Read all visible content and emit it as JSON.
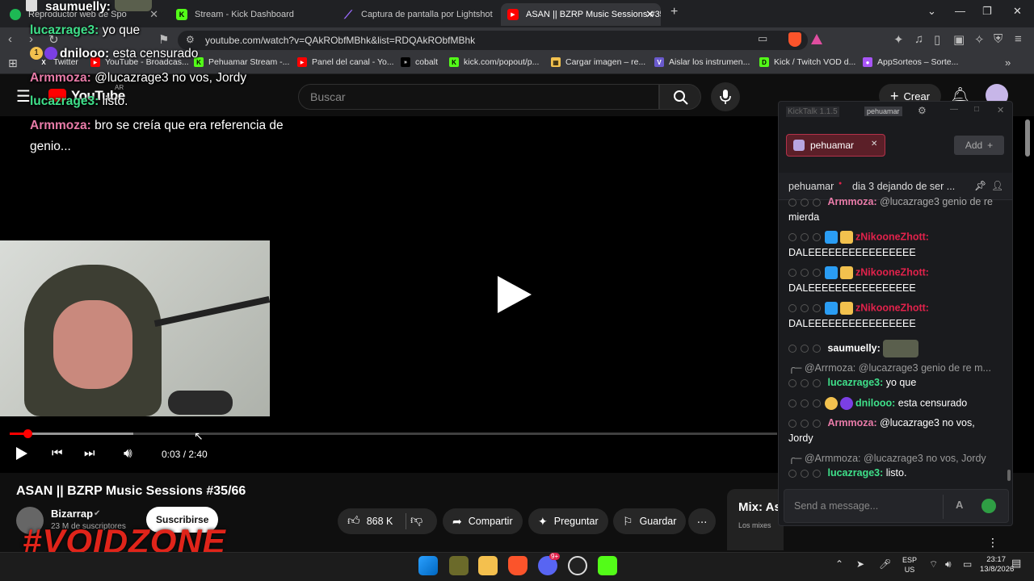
{
  "tabs": [
    {
      "title": "Reproductor web de Spo",
      "fav_color": "#1db954"
    },
    {
      "title": "Stream - Kick Dashboard",
      "fav_color": "#53fc18"
    },
    {
      "title": "Captura de pantalla por Lightshot",
      "fav_color": "#9b6bff"
    },
    {
      "title": "ASAN || BZRP Music Sessions #35/",
      "fav_color": "#ff0000",
      "active": true
    }
  ],
  "address": {
    "url": "youtube.com/watch?v=QAkRObfMBhk&list=RDQAkRObfMBhk"
  },
  "bookmarks": [
    {
      "label": "Twitter",
      "icon": "x-icon"
    },
    {
      "label": "YouTube - Broadcas...",
      "icon": "youtube-icon"
    },
    {
      "label": "Pehuamar Stream -...",
      "icon": "kick-icon"
    },
    {
      "label": "Panel del canal - Yo...",
      "icon": "youtube-icon"
    },
    {
      "label": "cobalt",
      "icon": "cobalt-icon"
    },
    {
      "label": "kick.com/popout/p...",
      "icon": "kick-icon"
    },
    {
      "label": "Cargar imagen – re...",
      "icon": "image-icon"
    },
    {
      "label": "Aislar los instrumen...",
      "icon": "v-icon"
    },
    {
      "label": "Kick / Twitch VOD d...",
      "icon": "d-icon"
    },
    {
      "label": "AppSorteos – Sorte...",
      "icon": "app-icon"
    }
  ],
  "youtube": {
    "logo_text": "YouTube",
    "region": "AR",
    "search_placeholder": "Buscar",
    "create_label": "Crear"
  },
  "overlay_chat": [
    {
      "user": "saumuelly:",
      "text": "",
      "color": "#ffffff"
    },
    {
      "user": "lucazrage3:",
      "text": "yo que",
      "color": "#3fe08a"
    },
    {
      "user": "dnilooo:",
      "text": "esta censurado",
      "color": "#3fe08a"
    },
    {
      "user": "Armmoza:",
      "text": "@lucazrage3 no vos, Jordy",
      "color": "#e87ba8"
    },
    {
      "user": "lucazrage3:",
      "text": "listo.",
      "color": "#3fe08a"
    },
    {
      "user": "Armmoza:",
      "text": "bro se creía que era referencia de",
      "color": "#e87ba8"
    },
    {
      "user": "",
      "text": "genio...",
      "color": "#ffffff"
    }
  ],
  "player": {
    "time": "0:03 / 2:40",
    "played_fraction": 0.019
  },
  "video": {
    "title": "ASAN || BZRP Music Sessions #35/66",
    "channel": "Bizarrap",
    "subs": "23 M de suscriptores",
    "subscribe_label": "Suscribirse",
    "likes": "868 K",
    "share_label": "Compartir",
    "ask_label": "Preguntar",
    "save_label": "Guardar",
    "mix_title": "Mix: As",
    "mix_sub": "Los mixes"
  },
  "watermark": "#VOIDZONE",
  "kicktalk": {
    "app_title": "KickTalk 1.1.5",
    "user_chip": "pehuamar",
    "channel_tab": "pehuamar",
    "add_label": "Add",
    "stream_channel": "pehuamar",
    "stream_title": "dia 3 dejando de ser ...",
    "input_placeholder": "Send a message...",
    "messages": [
      {
        "user": "Armmoza:",
        "text": "@lucazrage3 genio de re",
        "color": "#e87ba8",
        "partial": true
      },
      {
        "user": "",
        "text": "mierda",
        "color": "#ffffff"
      },
      {
        "user": "zNikooneZhott:",
        "text": "",
        "color": "#e0224b"
      },
      {
        "user": "",
        "text": "DALEEEEEEEEEEEEEEEE",
        "color": "#ffffff"
      },
      {
        "user": "zNikooneZhott:",
        "text": "",
        "color": "#e0224b"
      },
      {
        "user": "",
        "text": "DALEEEEEEEEEEEEEEEE",
        "color": "#ffffff"
      },
      {
        "user": "zNikooneZhott:",
        "text": "",
        "color": "#e0224b"
      },
      {
        "user": "",
        "text": "DALEEEEEEEEEEEEEEEE",
        "color": "#ffffff"
      },
      {
        "user": "saumuelly:",
        "text": "",
        "color": "#ffffff"
      },
      {
        "user": "@Arrmoza:",
        "text": "@lucazrage3 genio de re m...",
        "color": "#999999",
        "reply": true
      },
      {
        "user": "lucazrage3:",
        "text": "yo que",
        "color": "#3fe08a"
      },
      {
        "user": "dnilooo:",
        "text": "esta censurado",
        "color": "#3fe08a"
      },
      {
        "user": "Armmoza:",
        "text": "@lucazrage3 no vos,",
        "color": "#e87ba8"
      },
      {
        "user": "",
        "text": "Jordy",
        "color": "#ffffff"
      },
      {
        "user": "@Armmoza:",
        "text": "@lucazrage3 no vos, Jordy",
        "color": "#999999",
        "reply": true
      },
      {
        "user": "lucazrage3:",
        "text": "listo.",
        "color": "#3fe08a"
      }
    ]
  },
  "taskbar": {
    "lang": "ESP",
    "layout": "US",
    "time": "23:17",
    "date": "13/8/2026",
    "discord_badge": "9+"
  }
}
